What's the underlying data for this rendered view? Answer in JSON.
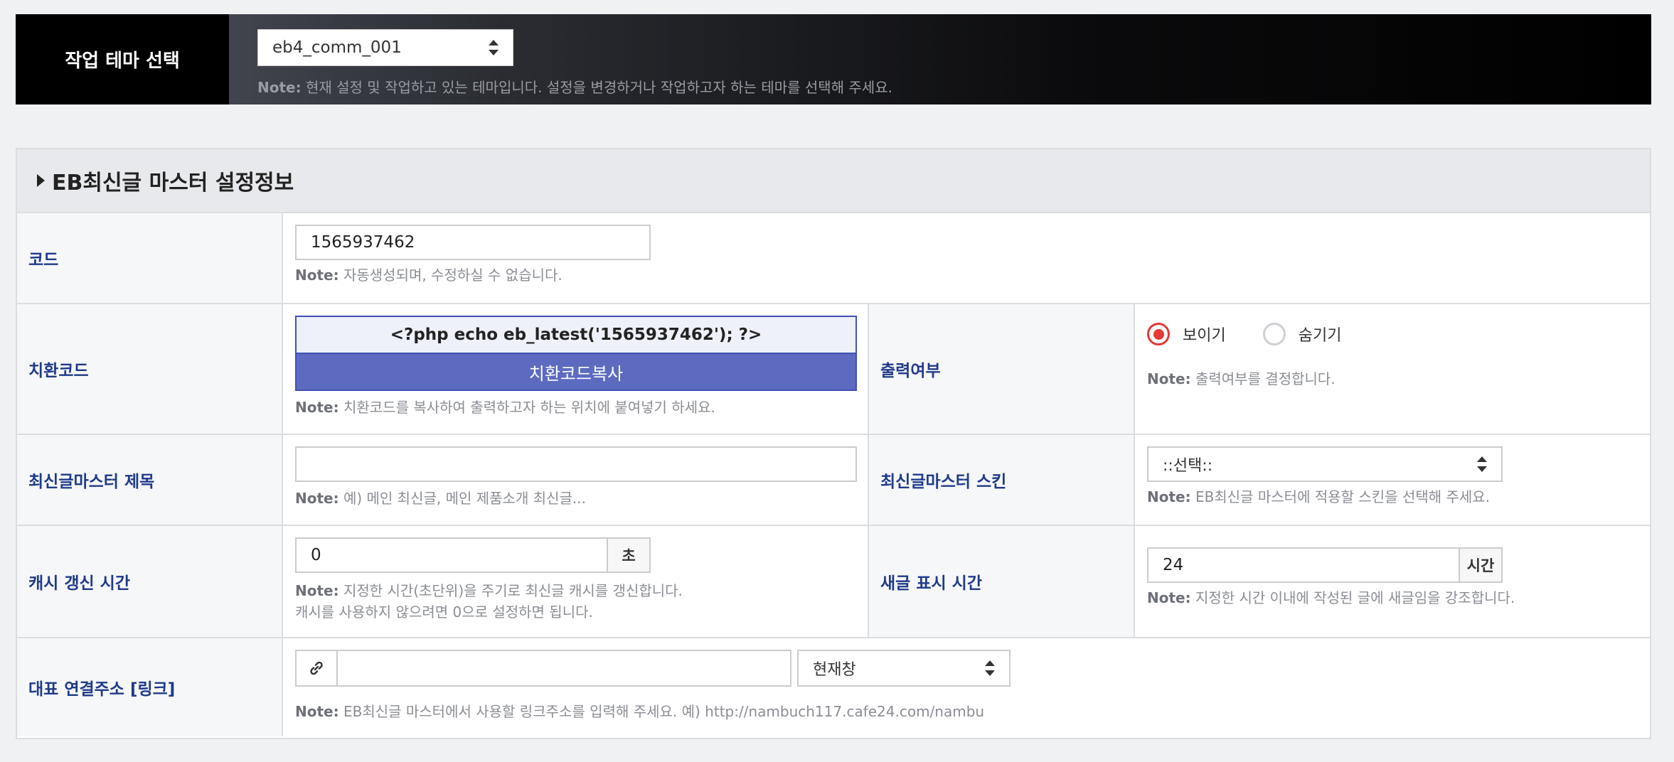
{
  "theme": {
    "label": "작업 테마 선택",
    "selected": "eb4_comm_001",
    "note_prefix": "Note:",
    "note": " 현재 설정 및 작업하고 있는 테마입니다. 설정을 변경하거나 작업하고자 하는 테마를 선택해 주세요."
  },
  "panel": {
    "title": "EB최신글 마스터 설정정보"
  },
  "note_prefix": "Note:",
  "code": {
    "label": "코드",
    "value": "1565937462",
    "note": " 자동생성되며, 수정하실 수 없습니다."
  },
  "replace": {
    "label": "치환코드",
    "code": "<?php echo eb_latest('1565937462'); ?>",
    "copy_label": "치환코드복사",
    "note": " 치환코드를 복사하여 출력하고자 하는 위치에 붙여넣기 하세요."
  },
  "output": {
    "label": "출력여부",
    "show_label": "보이기",
    "hide_label": "숨기기",
    "selected": "보이기",
    "note": " 출력여부를 결정합니다."
  },
  "title_field": {
    "label": "최신글마스터 제목",
    "value": "",
    "note": " 예) 메인 최신글, 메인 제품소개 최신글..."
  },
  "skin": {
    "label": "최신글마스터 스킨",
    "selected": "::선택::",
    "note": " EB최신글 마스터에 적용할 스킨을 선택해 주세요."
  },
  "cache": {
    "label": "캐시 갱신 시간",
    "value": "0",
    "unit": "초",
    "note_line1": " 지정한 시간(초단위)을 주기로 최신글 캐시를 갱신합니다.",
    "note_line2": "캐시를 사용하지 않으려면 0으로 설정하면 됩니다."
  },
  "new_time": {
    "label": "새글 표시 시간",
    "value": "24",
    "unit": "시간",
    "note": " 지정한 시간 이내에 작성된 글에 새글임을 강조합니다."
  },
  "link": {
    "label": "대표 연결주소 [링크]",
    "value": "",
    "target": "현재창",
    "note": " EB최신글 마스터에서 사용할 링크주소를 입력해 주세요. 예) http://nambuch117.cafe24.com/nambu"
  },
  "icons": {
    "link": "link-icon",
    "caret": "caret-right-icon",
    "updown": "updown-arrows-icon"
  },
  "colors": {
    "label_text": "#1f3a8a",
    "code_border": "#3f51b5",
    "copy_button": "#5c6bc0",
    "radio_on": "#e53935"
  }
}
